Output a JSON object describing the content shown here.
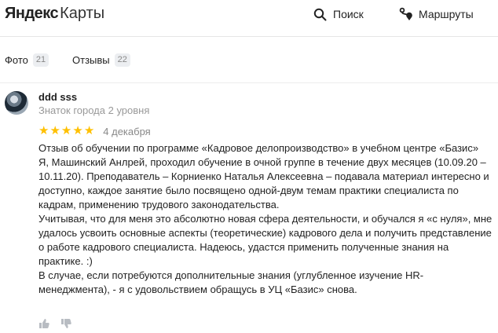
{
  "header": {
    "logo_brand": "Яндекс",
    "logo_product": "Карты",
    "search_label": "Поиск",
    "routes_label": "Маршруты"
  },
  "tabs": [
    {
      "label": "Фото",
      "count": "21"
    },
    {
      "label": "Отзывы",
      "count": "22"
    }
  ],
  "review": {
    "author": "ddd sss",
    "level": "Знаток города 2 уровня",
    "rating": 5,
    "date": "4 декабря",
    "paragraphs": [
      "Отзыв об обучении по программе «Кадровое делопроизводство» в учебном центре «Базис»",
      "Я, Машинский Анлрей, проходил обучение в очной группе в течение двух месяцев (10.09.20 – 10.11.20). Преподаватель – Корниенко Наталья Алексеевна – подавала материал интересно и доступно, каждое занятие было посвящено одной-двум темам практики специалиста по кадрам, применению трудового законодательства.",
      "Учитывая, что для меня это абсолютно новая сфера деятельности, и обучался я «с нуля», мне удалось усвоить основные аспекты (теоретические) кадрового дела и получить представление о работе кадрового специалиста. Надеюсь, удастся применить полученные знания на практике. :)",
      "В случае, если потребуются дополнительные знания (углубленное изучение HR-менеджмента), - я с удовольствием обращусь в УЦ «Базис» снова."
    ]
  },
  "colors": {
    "star": "#ffc000",
    "muted": "#999999",
    "badge_bg": "#eceef1"
  },
  "icons": [
    "search-icon",
    "route-icon",
    "star-icon",
    "like-icon",
    "dislike-icon"
  ]
}
